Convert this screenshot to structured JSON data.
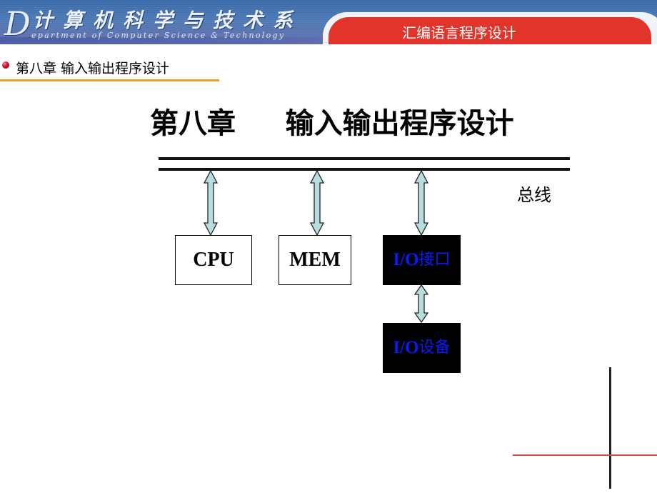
{
  "header": {
    "logo_letter": "D",
    "department_cn": "计算机科学与技术系",
    "department_en": "epartment of Computer Science & Technology",
    "course_title": "汇编语言程序设计",
    "colors": {
      "banner_blue": "#4a78b4",
      "course_tab_red": "#e2342a"
    }
  },
  "slide": {
    "section_heading": "第八章  输入输出程序设计",
    "main_title": "第八章     输入输出程序设计",
    "heading_rule_color": "#f0a020",
    "bullet_color": "#d0102e"
  },
  "diagram": {
    "bus_label": "总线",
    "nodes": [
      {
        "id": "cpu",
        "label": "CPU",
        "style": "white"
      },
      {
        "id": "mem",
        "label": "MEM",
        "style": "white"
      },
      {
        "id": "io_interface",
        "label_latin": "I/O",
        "label_cjk": "接口",
        "style": "black",
        "text_color": "#0a1aff"
      },
      {
        "id": "io_device",
        "label_latin": "I/O",
        "label_cjk": "设备",
        "style": "black",
        "text_color": "#0a1aff"
      }
    ],
    "edges": [
      {
        "from": "bus",
        "to": "cpu",
        "type": "bidirectional"
      },
      {
        "from": "bus",
        "to": "mem",
        "type": "bidirectional"
      },
      {
        "from": "bus",
        "to": "io_interface",
        "type": "bidirectional"
      },
      {
        "from": "io_interface",
        "to": "io_device",
        "type": "bidirectional"
      }
    ],
    "arrow_fill": "#b8dde0"
  }
}
